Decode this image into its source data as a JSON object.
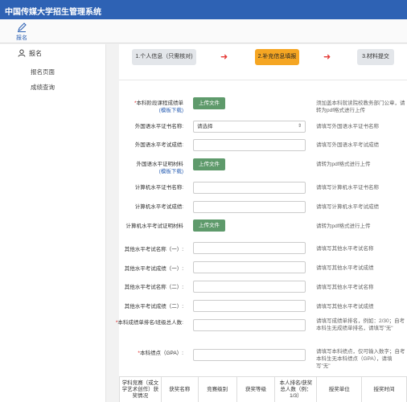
{
  "header": {
    "title": "中国传媒大学招生管理系统"
  },
  "nav": {
    "label": "报名",
    "icon": "pen-icon"
  },
  "sidebar": {
    "head": "报名",
    "items": [
      {
        "label": "报名页面"
      },
      {
        "label": "成绩查询"
      }
    ]
  },
  "steps": [
    {
      "label": "1.个人信息（只需核对)"
    },
    {
      "label": "2.补充信息填报"
    },
    {
      "label": "3.材料提交"
    }
  ],
  "colors": {
    "brand": "#2e62b4",
    "active_step": "#f5a623",
    "arrow": "#e53935",
    "upload": "#5e9a6b",
    "required": "#d22"
  },
  "form": {
    "transcript": {
      "label": "本科阶段课程成绩单",
      "template": "(模板下载)",
      "button": "上传文件",
      "hint": "须加盖本科就读院校教务部门公章，请转为pdf格式进行上传"
    },
    "lang_cert": {
      "label": "外国语水平证书名称:",
      "value": "请选择",
      "hint": "请填写外国语水平证书名称"
    },
    "lang_score": {
      "label": "外国语水平考试成绩:",
      "value": "",
      "hint": "请填写外国语水平考试成绩"
    },
    "lang_material": {
      "label": "外国语水平证明材料",
      "template": "(模板下载)",
      "button": "上传文件",
      "hint": "请转为pdf格式进行上传"
    },
    "cs_cert": {
      "label": "计算机水平证书名称:",
      "value": "",
      "hint": "请填写计算机水平证书名称"
    },
    "cs_score": {
      "label": "计算机水平考试成绩:",
      "value": "",
      "hint": "请填写计算机水平考试成绩"
    },
    "cs_material": {
      "label": "计算机水平考试证明材料",
      "button": "上传文件",
      "hint": "请转为pdf格式进行上传"
    },
    "other_name1": {
      "label": "其他水平考试名称（一）:",
      "value": "",
      "hint": "请填写其他水平考试名称"
    },
    "other_score1": {
      "label": "其他水平考试成绩（一）:",
      "value": "",
      "hint": "请填写其他水平考试成绩"
    },
    "other_name2": {
      "label": "其他水平考试名称（二）:",
      "value": "",
      "hint": "请填写其他水平考试名称"
    },
    "other_score2": {
      "label": "其他水平考试成绩（二）:",
      "value": "",
      "hint": "请填写其他水平考试成绩"
    },
    "rank": {
      "label": "本科成绩单排名/班级总人数:",
      "value": "",
      "hint": "请填写成绩单排名，例如：2/30；自考本科生无成绩单排名，请填写\"无\""
    },
    "gpa": {
      "label": "本科绩点（GPA）:",
      "value": "",
      "hint": "请填写本科绩点，仅可输入数字；自考本科生无本科绩点（GPA），请填写\"无\""
    }
  },
  "awards_table": {
    "headers": [
      "学科竞赛（或文学艺术创作）获奖情况",
      "获奖名称",
      "竞赛级别",
      "获奖等级",
      "本人排名/获奖总人数（例：1/3）",
      "授奖单位",
      "授奖时间"
    ]
  }
}
